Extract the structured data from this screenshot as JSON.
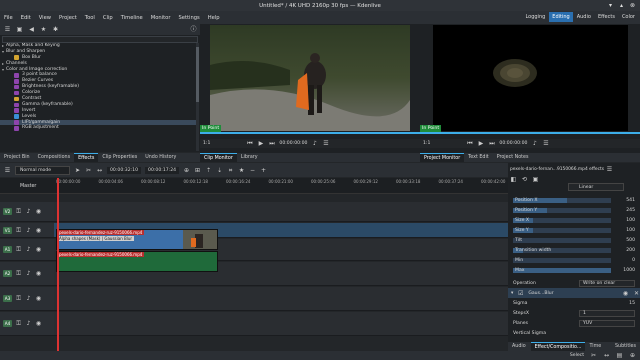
{
  "window": {
    "title": "Untitled* / 4K UHD 2160p 30 fps — Kdenlive"
  },
  "menu": [
    "File",
    "Edit",
    "View",
    "Project",
    "Tool",
    "Clip",
    "Timeline",
    "Monitor",
    "Settings",
    "Help"
  ],
  "layouts": [
    "Logging",
    "Editing",
    "Audio",
    "Effects",
    "Color"
  ],
  "active_layout": "Editing",
  "effects_tree": [
    {
      "label": "Alpha, Mask and Keying",
      "type": "cat",
      "open": false
    },
    {
      "label": "Blur and Sharpen",
      "type": "cat",
      "open": true
    },
    {
      "label": "Box Blur",
      "type": "item",
      "color": "#d4a531"
    },
    {
      "label": "Channels",
      "type": "cat",
      "open": false
    },
    {
      "label": "Color and Image correction",
      "type": "cat",
      "open": true
    },
    {
      "label": "3 point balance",
      "type": "item",
      "color": "#8e44ad"
    },
    {
      "label": "Bezier Curves",
      "type": "item",
      "color": "#8e44ad"
    },
    {
      "label": "Brightness (keyframable)",
      "type": "item",
      "color": "#8e44ad"
    },
    {
      "label": "Colorize",
      "type": "item",
      "color": "#8e44ad"
    },
    {
      "label": "Contrast",
      "type": "item",
      "color": "#d4a531"
    },
    {
      "label": "Gamma (keyframable)",
      "type": "item",
      "color": "#8e44ad"
    },
    {
      "label": "Invert",
      "type": "item",
      "color": "#8e44ad"
    },
    {
      "label": "Levels",
      "type": "item",
      "color": "#3a8fd6"
    },
    {
      "label": "LIFt/gamma/gain",
      "type": "item",
      "color": "#8e44ad",
      "selected": true
    },
    {
      "label": "RGB adjustment",
      "type": "item",
      "color": "#8e44ad"
    }
  ],
  "left_tabs": [
    "Project Bin",
    "Compositions",
    "Effects",
    "Clip Properties",
    "Undo History"
  ],
  "left_tab_active": "Effects",
  "clip_monitor": {
    "in_label": "In Point",
    "zoom": "1:1",
    "timecode": "00:00:00:00"
  },
  "project_monitor": {
    "in_label": "In Point",
    "zoom": "1:1",
    "timecode": "00:00:00:00"
  },
  "clip_monitor_tabs": [
    "Clip Monitor",
    "Library"
  ],
  "project_tabs": [
    "Project Monitor",
    "Text Edit",
    "Project Notes"
  ],
  "timeline": {
    "mode": "Normal mode",
    "position": "00:00:32:10",
    "duration": "00:00:17:24",
    "master": "Master",
    "ruler": [
      "00:00:00:00",
      "00:00:04:06",
      "00:00:08:12",
      "00:00:12:18",
      "00:00:16:24",
      "00:00:21:00",
      "00:00:25:06",
      "00:00:29:12",
      "00:00:33:18",
      "00:00:37:24",
      "00:00:42:00",
      "00:00:46:06"
    ],
    "tracks": [
      "V2",
      "V1",
      "A1",
      "A2",
      "A3",
      "A4"
    ],
    "clip_name": "pexels-dario-fernandez-ruz-9150066.mp4",
    "clip_effect": "Alpha shapes (Mask) | Gaussian Blur"
  },
  "effect_stack": {
    "header": "pexels-dario-fernan...9150066.mp4 effects",
    "blend": "Linear",
    "params": [
      {
        "label": "Position X",
        "value": "541",
        "fill": 0.55
      },
      {
        "label": "Position Y",
        "value": "245",
        "fill": 0.35
      },
      {
        "label": "Size X",
        "value": "100",
        "fill": 0.2
      },
      {
        "label": "Size Y",
        "value": "100",
        "fill": 0.2
      },
      {
        "label": "Tilt",
        "value": "500",
        "fill": 0.0
      },
      {
        "label": "Transition width",
        "value": "200",
        "fill": 0.1
      },
      {
        "label": "Min",
        "value": "0",
        "fill": 0.0
      },
      {
        "label": "Max",
        "value": "1000",
        "fill": 1.0
      }
    ],
    "operation_label": "Operation",
    "operation_value": "Write on clear",
    "effect2": "Gaus...Blur",
    "sigma_label": "Sigma",
    "sigma_value": "15",
    "stepsX_label": "StepsX",
    "stepsX": "1",
    "planes_label": "Planes",
    "planes": "YUV",
    "vsigma_label": "Vertical Sigma"
  },
  "right_tabs": [
    "Audio M...",
    "Effect/Compositio...",
    "Time Rem...",
    "Subtitles"
  ],
  "right_tab_active": "Effect/Compositio...",
  "status": {
    "select": "Select"
  }
}
